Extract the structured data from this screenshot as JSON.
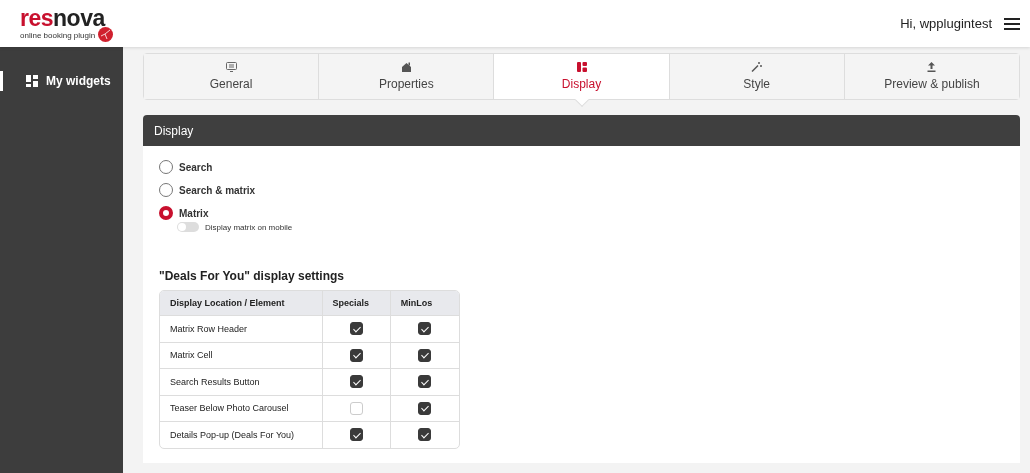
{
  "header": {
    "logo": {
      "accent": "res",
      "rest": "nova",
      "tagline": "online booking plugin"
    },
    "greeting": "Hi, wpplugintest"
  },
  "sidebar": {
    "items": [
      {
        "label": "My widgets",
        "selected": true
      }
    ]
  },
  "tabs": [
    {
      "label": "General",
      "selected": false
    },
    {
      "label": "Properties",
      "selected": false
    },
    {
      "label": "Display",
      "selected": true
    },
    {
      "label": "Style",
      "selected": false
    },
    {
      "label": "Preview & publish",
      "selected": false
    }
  ],
  "panel": {
    "title": "Display",
    "options": [
      {
        "label": "Search",
        "selected": false
      },
      {
        "label": "Search & matrix",
        "selected": false
      },
      {
        "label": "Matrix",
        "selected": true
      }
    ],
    "toggle": {
      "label": "Display matrix on mobile",
      "on": false
    },
    "deals": {
      "title": "\"Deals For You\" display settings",
      "columns": [
        "Display Location / Element",
        "Specials",
        "MinLos"
      ],
      "rows": [
        {
          "label": "Matrix Row Header",
          "specials": true,
          "minlos": true
        },
        {
          "label": "Matrix Cell",
          "specials": true,
          "minlos": true
        },
        {
          "label": "Search Results Button",
          "specials": true,
          "minlos": true
        },
        {
          "label": "Teaser Below Photo Carousel",
          "specials": false,
          "minlos": true
        },
        {
          "label": "Details Pop-up (Deals For You)",
          "specials": true,
          "minlos": true
        }
      ]
    }
  }
}
